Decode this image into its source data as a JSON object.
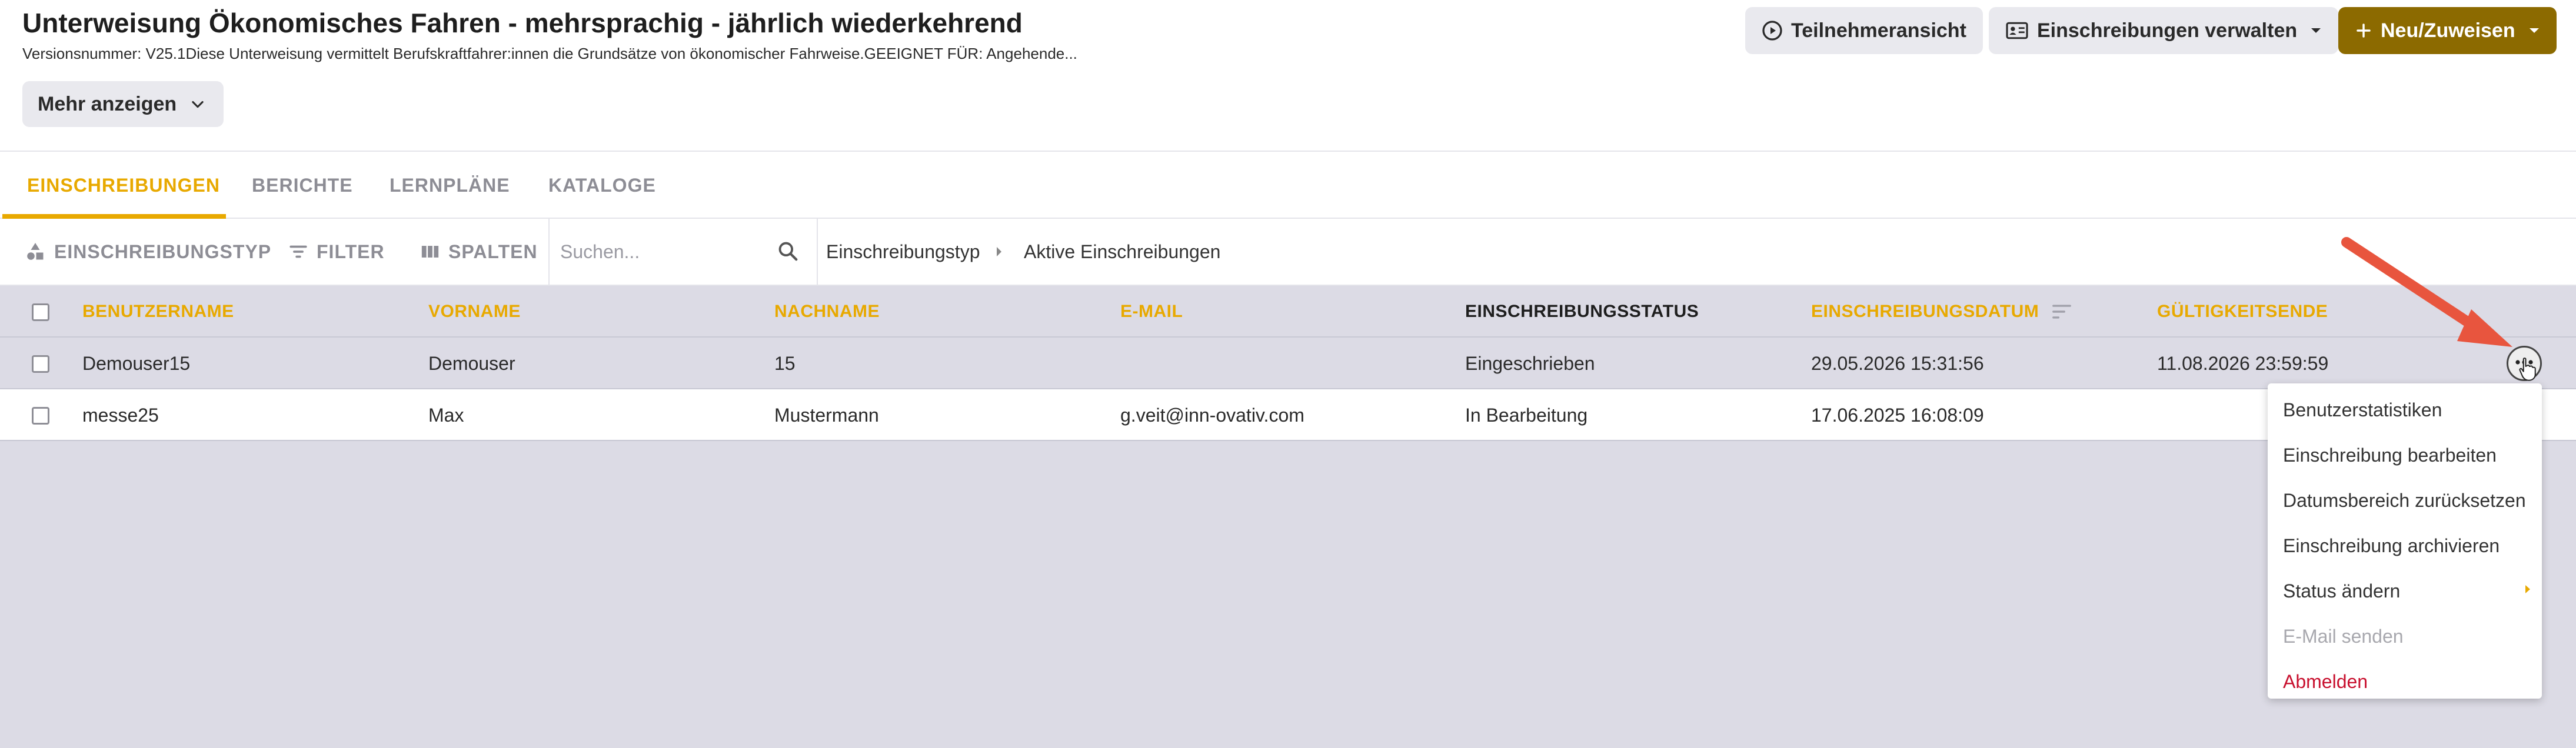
{
  "header": {
    "title": "Unterweisung Ökonomisches Fahren - mehrsprachig - jährlich wiederkehrend",
    "subtitle": "Versionsnummer: V25.1Diese Unterweisung vermittelt Berufskraftfahrer:innen die Grundsätze von ökonomischer Fahrweise.GEEIGNET FÜR: Angehende...",
    "more_label": "Mehr anzeigen",
    "participant_view_label": "Teilnehmeransicht",
    "manage_enrollments_label": "Einschreibungen verwalten",
    "new_assign_label": "Neu/Zuweisen"
  },
  "tabs": [
    "EINSCHREIBUNGEN",
    "BERICHTE",
    "LERNPLÄNE",
    "KATALOGE"
  ],
  "toolbar": {
    "enrollment_type_label": "EINSCHREIBUNGSTYP",
    "filter_label": "FILTER",
    "columns_label": "SPALTEN",
    "search_placeholder": "Suchen...",
    "breadcrumb_1": "Einschreibungstyp",
    "breadcrumb_2": "Aktive Einschreibungen"
  },
  "table": {
    "columns": [
      "BENUTZERNAME",
      "VORNAME",
      "NACHNAME",
      "E-MAIL",
      "EINSCHREIBUNGSSTATUS",
      "EINSCHREIBUNGSDATUM",
      "GÜLTIGKEITSENDE"
    ],
    "rows": [
      [
        "Demouser15",
        "Demouser",
        "15",
        "",
        "Eingeschrieben",
        "29.05.2026 15:31:56",
        "11.08.2026 23:59:59"
      ],
      [
        "messe25",
        "Max",
        "Mustermann",
        "g.veit@inn-ovativ.com",
        "In Bearbeitung",
        "17.06.2025 16:08:09",
        ""
      ]
    ]
  },
  "context_menu": {
    "items": [
      "Benutzerstatistiken",
      "Einschreibung bearbeiten",
      "Datumsbereich zurücksetzen",
      "Einschreibung archivieren",
      "Status ändern",
      "E-Mail senden",
      "Abmelden"
    ]
  },
  "colors": {
    "accent": "#e8a900",
    "primary_button": "#8c6a00",
    "danger": "#c8102e",
    "grid_background": "#dcdbe5",
    "annotation_arrow": "#e8553e"
  }
}
